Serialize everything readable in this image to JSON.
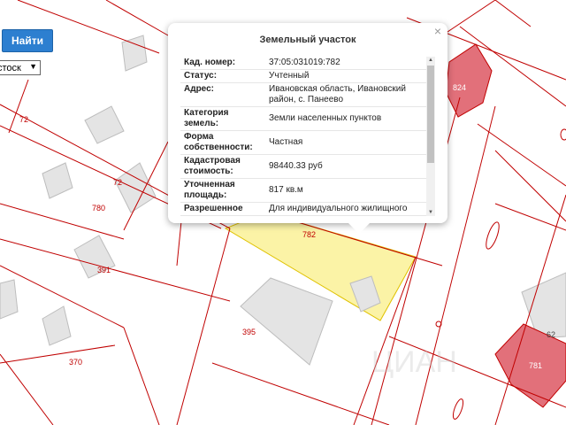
{
  "search": {
    "button_label": "Найти",
    "layer_select": "стоск"
  },
  "popup": {
    "title": "Земельный участок",
    "close_symbol": "×",
    "rows": [
      {
        "k1": "Кад. номер:",
        "v1": "37:05:031019:782"
      },
      {
        "k1": "Статус:",
        "v1": "Учтенный"
      },
      {
        "k1": "Адрес:",
        "v1": "Ивановская область, Ивановский",
        "v2": "район, с. Панеево"
      },
      {
        "k1": "Категория",
        "k2": "земель:",
        "v1": "Земли населенных пунктов"
      },
      {
        "k1": "Форма",
        "k2": "собственности:",
        "v1": "Частная"
      },
      {
        "k1": "Кадастровая",
        "k2": "стоимость:",
        "v1": "98440.33 руб"
      },
      {
        "k1": "Уточненная",
        "k2": "площадь:",
        "v1": "817 кв.м"
      },
      {
        "k1": "Разрешенное",
        "v1": "Для индивидуального жилищного"
      }
    ]
  },
  "map": {
    "parcel_labels": {
      "p72a": "72",
      "p72b": "72",
      "p780": "780",
      "p391": "391",
      "p370": "370",
      "p395": "395",
      "p782": "782",
      "p824": "824",
      "p781": "781",
      "p62": "62"
    },
    "watermark": "ЦИАН",
    "colors": {
      "highlight": "#fbf3a6",
      "building_red": "#e2707a",
      "boundary": "#c00000"
    }
  }
}
